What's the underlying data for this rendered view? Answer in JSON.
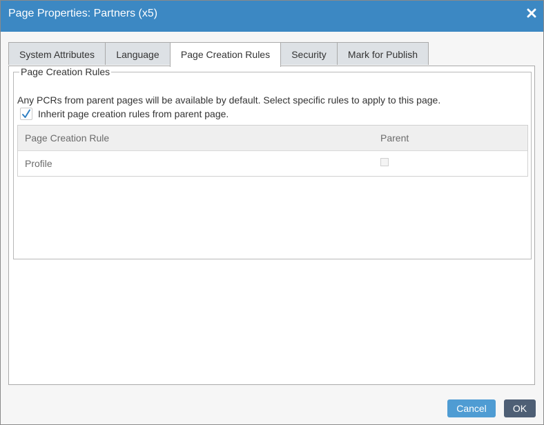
{
  "dialog": {
    "title": "Page Properties: Partners (x5)",
    "close_icon": "close-icon"
  },
  "tabs": [
    {
      "label": "System Attributes",
      "active": false
    },
    {
      "label": "Language",
      "active": false
    },
    {
      "label": "Page Creation Rules",
      "active": true
    },
    {
      "label": "Security",
      "active": false
    },
    {
      "label": "Mark for Publish",
      "active": false
    }
  ],
  "group": {
    "legend": "Page Creation Rules",
    "description": "Any PCRs from parent pages will be available by default. Select specific rules to apply to this page.",
    "inherit_label": "Inherit page creation rules from parent page.",
    "inherit_checked": true
  },
  "grid": {
    "columns": [
      "Page Creation Rule",
      "Parent"
    ],
    "rows": [
      {
        "rule": "Profile",
        "parent": false
      }
    ]
  },
  "buttons": {
    "cancel": "Cancel",
    "ok": "OK"
  },
  "colors": {
    "titlebar": "#3c88c3",
    "cancel_button": "#4f9cd3",
    "ok_button": "#4e5f75",
    "checkmark": "#2f7fc2"
  }
}
